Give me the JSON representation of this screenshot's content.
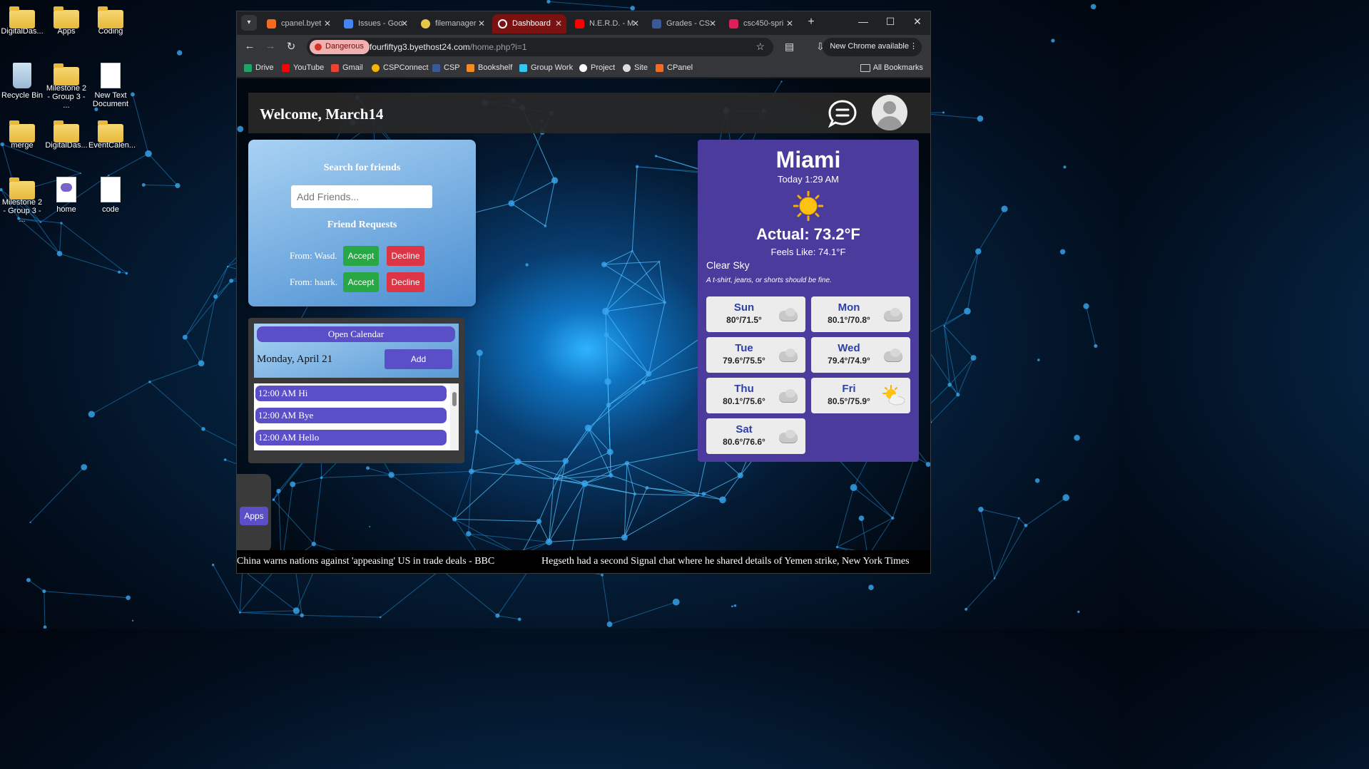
{
  "desktop": {
    "icons": [
      {
        "label": "DigitalDas..."
      },
      {
        "label": "Apps"
      },
      {
        "label": "Coding"
      },
      {
        "label": "Recycle Bin"
      },
      {
        "label": "Milestone 2 - Group 3 - ..."
      },
      {
        "label": "New Text Document"
      },
      {
        "label": "merge"
      },
      {
        "label": "DigitalDas..."
      },
      {
        "label": "EventCalen..."
      },
      {
        "label": "Milestone 2 - Group 3 - ..."
      },
      {
        "label": "home"
      },
      {
        "label": "code"
      }
    ]
  },
  "browser": {
    "tabs": [
      {
        "label": "cpanel.byet",
        "color": "#f26b21"
      },
      {
        "label": "Issues - Goo",
        "color": "#4285f4"
      },
      {
        "label": "filemanager",
        "color": "#e6c84a"
      },
      {
        "label": "Dashboard",
        "color": "#ffffff"
      },
      {
        "label": "N.E.R.D. - M",
        "color": "#ff0000"
      },
      {
        "label": "Grades - CS",
        "color": "#3b5998"
      },
      {
        "label": "csc450-spri",
        "color": "#e01e5a"
      }
    ],
    "new_tab": "+",
    "danger_label": "Dangerous",
    "url_host": "fourfiftyg3.byethost24.com",
    "url_path": "/home.php?i=1",
    "new_chrome": "New Chrome available",
    "bookmarks": [
      {
        "label": "Drive",
        "color": "#1fa463"
      },
      {
        "label": "YouTube",
        "color": "#ff0000"
      },
      {
        "label": "Gmail",
        "color": "#ea4335"
      },
      {
        "label": "CSPConnect",
        "color": "#f4b400"
      },
      {
        "label": "CSP",
        "color": "#3b5998"
      },
      {
        "label": "Bookshelf",
        "color": "#f28b21"
      },
      {
        "label": "Group Work",
        "color": "#36c5f0"
      },
      {
        "label": "Project",
        "color": "#ffffff"
      },
      {
        "label": "Site",
        "color": "#dddddd"
      },
      {
        "label": "CPanel",
        "color": "#f26b21"
      }
    ],
    "all_bookmarks": "All Bookmarks"
  },
  "page": {
    "welcome": "Welcome, March14",
    "friends": {
      "title": "Search for friends",
      "placeholder": "Add Friends...",
      "requests_title": "Friend Requests",
      "requests": [
        {
          "from": "From: Wasd.",
          "accept": "Accept",
          "decline": "Decline"
        },
        {
          "from": "From: haark.",
          "accept": "Accept",
          "decline": "Decline"
        }
      ]
    },
    "calendar": {
      "open_label": "Open Calendar",
      "date": "Monday, April 21",
      "add_label": "Add",
      "events": [
        "12:00 AM Hi",
        "12:00 AM Bye",
        "12:00 AM Hello"
      ]
    },
    "apps_label": "Apps",
    "news": [
      "China warns nations against 'appeasing' US in trade deals - BBC",
      "Hegseth had a second Signal chat where he shared details of Yemen strike, New York Times"
    ],
    "weather": {
      "city": "Miami",
      "time": "Today 1:29 AM",
      "actual": "Actual: 73.2°F",
      "feels": "Feels Like: 74.1°F",
      "condition": "Clear Sky",
      "advice": "A t-shirt, jeans, or shorts should be fine.",
      "forecast": [
        {
          "day": "Sun",
          "temps": "80°/71.5°",
          "icon": "cloud-icon"
        },
        {
          "day": "Mon",
          "temps": "80.1°/70.8°",
          "icon": "cloud-icon"
        },
        {
          "day": "Tue",
          "temps": "79.6°/75.5°",
          "icon": "cloud-icon"
        },
        {
          "day": "Wed",
          "temps": "79.4°/74.9°",
          "icon": "cloud-icon"
        },
        {
          "day": "Thu",
          "temps": "80.1°/75.6°",
          "icon": "cloud-icon"
        },
        {
          "day": "Fri",
          "temps": "80.5°/75.9°",
          "icon": "partly-sunny-icon"
        },
        {
          "day": "Sat",
          "temps": "80.6°/76.6°",
          "icon": "cloud-icon"
        }
      ]
    }
  }
}
